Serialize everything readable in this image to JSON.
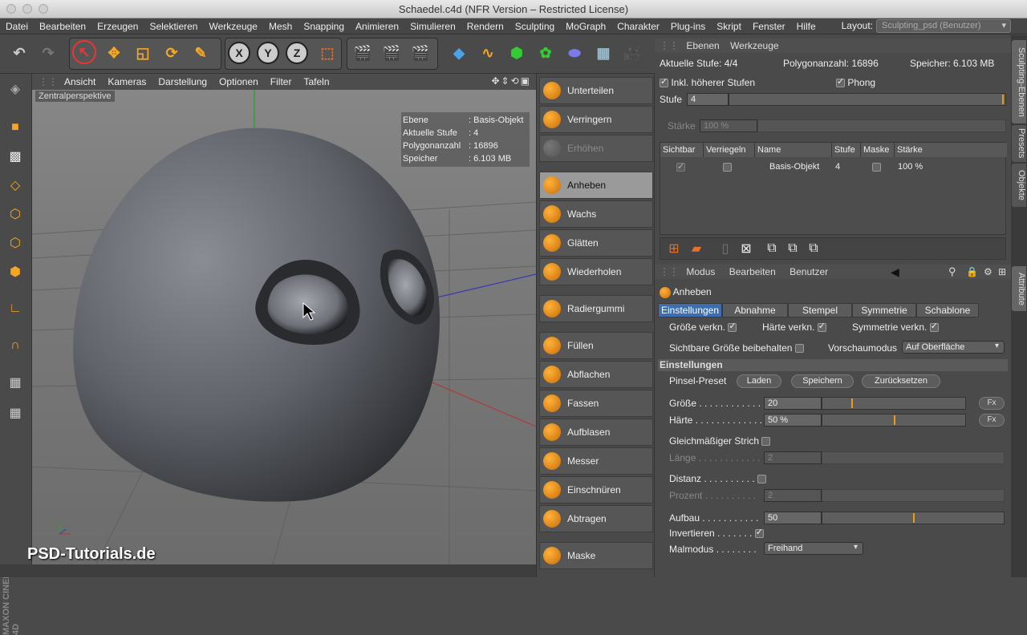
{
  "window": {
    "title": "Schaedel.c4d (NFR Version – Restricted License)"
  },
  "menu": [
    "Datei",
    "Bearbeiten",
    "Erzeugen",
    "Selektieren",
    "Werkzeuge",
    "Mesh",
    "Snapping",
    "Animieren",
    "Simulieren",
    "Rendern",
    "Sculpting",
    "MoGraph",
    "Charakter",
    "Plug-ins",
    "Skript",
    "Fenster",
    "Hilfe"
  ],
  "layout": {
    "label": "Layout:",
    "value": "Sculpting_psd (Benutzer)"
  },
  "toolbar": {
    "axis_x": "X",
    "axis_y": "Y",
    "axis_z": "Z"
  },
  "viewport": {
    "menu": [
      "Ansicht",
      "Kameras",
      "Darstellung",
      "Optionen",
      "Filter",
      "Tafeln"
    ],
    "label": "Zentralperspektive",
    "info": [
      {
        "k": "Ebene",
        "v": ": Basis-Objekt"
      },
      {
        "k": "Aktuelle Stufe",
        "v": ": 4"
      },
      {
        "k": "Polygonanzahl",
        "v": ": 16896"
      },
      {
        "k": "Speicher",
        "v": ": 6.103 MB"
      }
    ]
  },
  "brushes": [
    {
      "label": "Unterteilen",
      "state": "normal"
    },
    {
      "label": "Verringern",
      "state": "normal"
    },
    {
      "label": "Erhöhen",
      "state": "disabled"
    },
    {
      "label": "Anheben",
      "state": "selected"
    },
    {
      "label": "Wachs",
      "state": "normal"
    },
    {
      "label": "Glätten",
      "state": "normal"
    },
    {
      "label": "Wiederholen",
      "state": "normal"
    },
    {
      "label": "Radiergummi",
      "state": "normal"
    },
    {
      "label": "Füllen",
      "state": "normal"
    },
    {
      "label": "Abflachen",
      "state": "normal"
    },
    {
      "label": "Fassen",
      "state": "normal"
    },
    {
      "label": "Aufblasen",
      "state": "normal"
    },
    {
      "label": "Messer",
      "state": "normal"
    },
    {
      "label": "Einschnüren",
      "state": "normal"
    },
    {
      "label": "Abtragen",
      "state": "normal"
    },
    {
      "label": "Maske",
      "state": "normal"
    }
  ],
  "layers": {
    "tabs": [
      "Ebenen",
      "Werkzeuge"
    ],
    "stufe_label": "Aktuelle Stufe: 4/4",
    "poly_label": "Polygonanzahl: 16896",
    "mem_label": "Speicher: 6.103 MB",
    "inkl": "Inkl. höherer Stufen",
    "phong": "Phong",
    "stufe": "Stufe",
    "stufe_val": "4",
    "staerke": "Stärke",
    "staerke_val": "100 %",
    "cols": [
      "Sichtbar",
      "Verriegeln",
      "Name",
      "Stufe",
      "Maske",
      "Stärke"
    ],
    "row": {
      "name": "Basis-Objekt",
      "stufe": "4",
      "staerke": "100 %"
    }
  },
  "attr": {
    "menu": [
      "Modus",
      "Bearbeiten",
      "Benutzer"
    ],
    "tool": "Anheben",
    "tabs": [
      "Einstellungen",
      "Abnahme",
      "Stempel",
      "Symmetrie",
      "Schablone"
    ],
    "grosse_verkn": "Größe verkn.",
    "haerte_verkn": "Härte verkn.",
    "sym_verkn": "Symmetrie verkn.",
    "sichtbar": "Sichtbare Größe beibehalten",
    "vorschau": "Vorschaumodus",
    "vorschau_val": "Auf Oberfläche",
    "section": "Einstellungen",
    "preset": "Pinsel-Preset",
    "laden": "Laden",
    "speichern": "Speichern",
    "reset": "Zurücksetzen",
    "groesse": "Größe . . . . . . . . . . . .",
    "groesse_val": "20",
    "groesse_level": 0.2,
    "haerte": "Härte . . . . . . . . . . . . .",
    "haerte_val": "50 %",
    "haerte_level": 0.5,
    "fx": "Fx",
    "gleich": "Gleichmäßiger Strich",
    "laenge": "Länge . . . . . . . . . . . .",
    "laenge_val": "2",
    "distanz": "Distanz . . . . . . . . . .",
    "prozent": "Prozent . . . . . . . . . .",
    "prozent_val": "2",
    "aufbau": "Aufbau . . . . . . . . . . .",
    "aufbau_val": "50",
    "aufbau_level": 0.5,
    "invertieren": "Invertieren . . . . . . .",
    "malmodus": "Malmodus . . . . . . . .",
    "malmodus_val": "Freihand"
  },
  "sidetabs": [
    "Sculpting-Ebenen",
    "Presets",
    "Objekte",
    "Attribute"
  ],
  "watermark": "PSD-Tutorials.de",
  "maxon": "MAXON CINEMA 4D",
  "colors": {
    "accent": "#e89c1a",
    "selected_tab": "#3d6fb0"
  }
}
